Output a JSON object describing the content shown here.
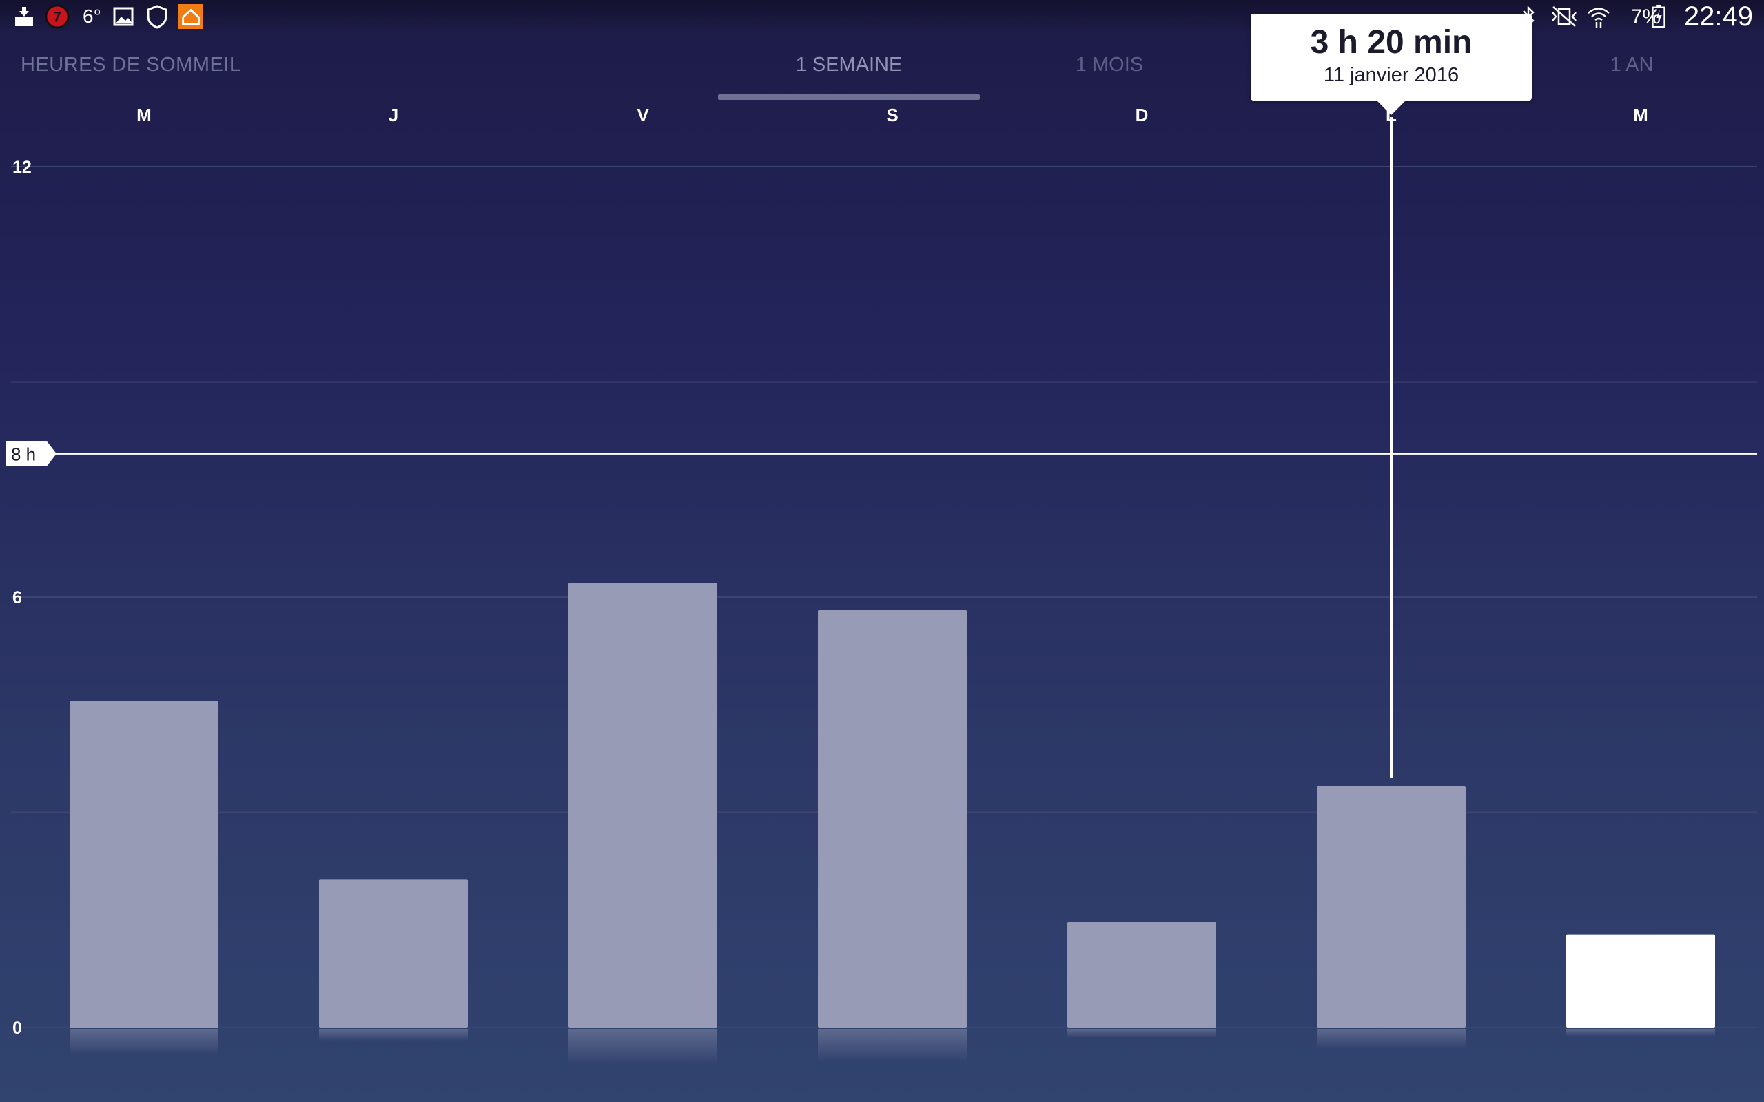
{
  "status_bar": {
    "notifications": [
      "download-icon",
      "badge-7-icon",
      "weather-icon",
      "image-icon",
      "shield-icon",
      "home-app-icon"
    ],
    "badge_count": "7",
    "temperature": "6°",
    "right_icons": [
      "bluetooth-icon",
      "vibrate-icon",
      "wifi-icon",
      "battery-icon"
    ],
    "battery_percent": "7%",
    "clock": "22:49"
  },
  "header": {
    "title": "HEURES DE SOMMEIL",
    "tabs": [
      {
        "label": "1 SEMAINE",
        "active": true
      },
      {
        "label": "1 MOIS",
        "active": false
      },
      {
        "label": "1 AN",
        "active": false
      }
    ]
  },
  "tooltip": {
    "value": "3 h 20 min",
    "date": "11 janvier 2016"
  },
  "chart_data": {
    "type": "bar",
    "categories": [
      "M",
      "J",
      "V",
      "S",
      "D",
      "L",
      "M"
    ],
    "values": [
      4.55,
      2.07,
      6.2,
      5.82,
      1.47,
      3.37,
      1.3
    ],
    "highlight_index": 6,
    "selected_index": 5,
    "y_ticks": [
      "12",
      "6",
      "0"
    ],
    "ylim": [
      0,
      12
    ],
    "goal_line": {
      "value": 8,
      "label": "8 h"
    },
    "grid": true,
    "colors": {
      "bar": "#979bb5",
      "bar_current": "#ffffff",
      "goal_line": "#ffffff",
      "grid": "#3d4470"
    }
  }
}
